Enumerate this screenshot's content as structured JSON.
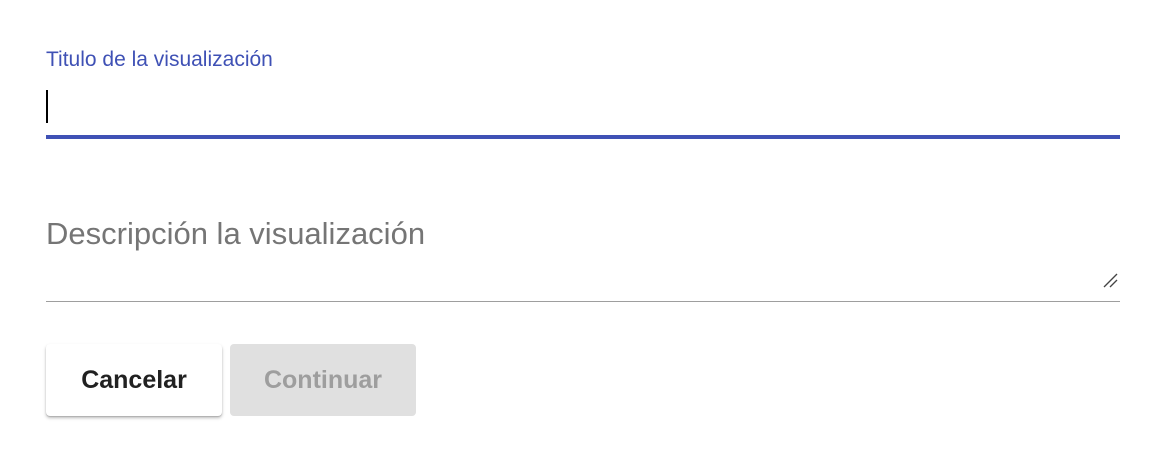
{
  "form": {
    "title_field": {
      "label": "Titulo de la visualización",
      "value": "",
      "focused": true
    },
    "description_field": {
      "placeholder": "Descripción la visualización",
      "value": ""
    },
    "actions": {
      "cancel_label": "Cancelar",
      "continue_label": "Continuar",
      "continue_disabled": true
    }
  },
  "colors": {
    "accent": "#3f51b5",
    "placeholder_text": "#757575",
    "underline": "#9e9e9e",
    "disabled_button_bg": "#e0e0e0",
    "disabled_button_text": "#9e9e9e"
  },
  "icons": {
    "resize_grip": "resize-handle-icon"
  }
}
